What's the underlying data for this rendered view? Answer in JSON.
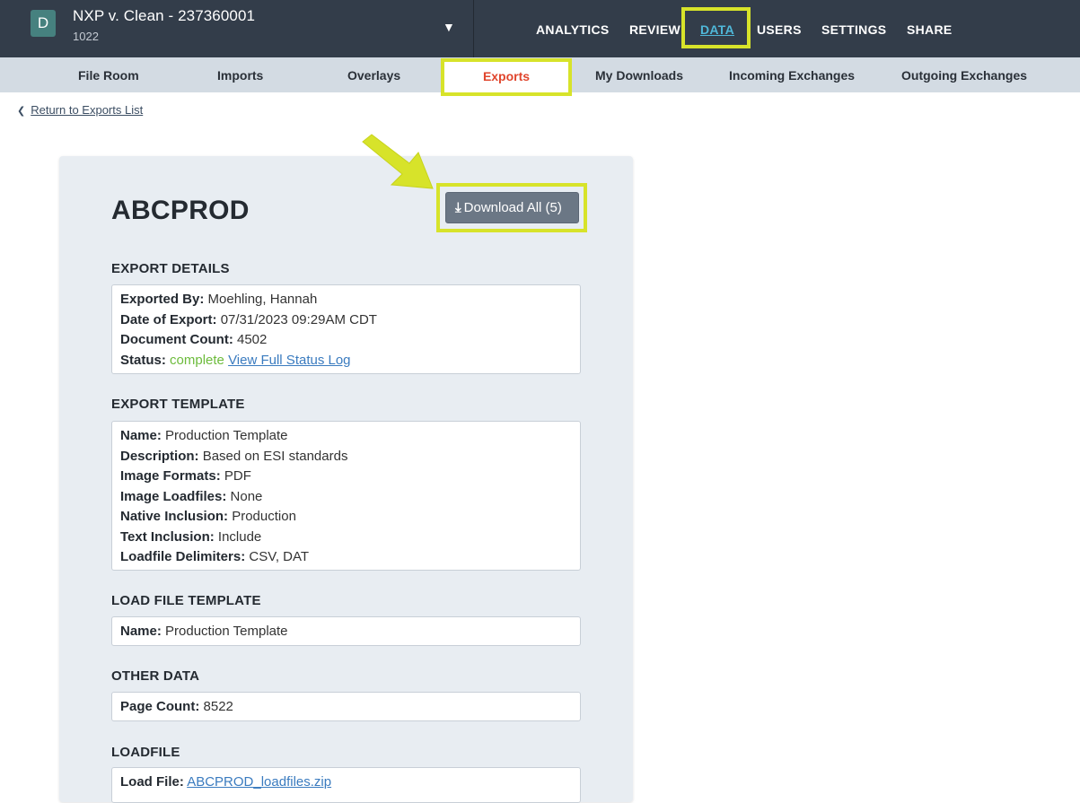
{
  "matter": {
    "badge": "D",
    "title": "NXP v. Clean - 237360001",
    "subtitle": "1022",
    "caret": "▼"
  },
  "main_nav": [
    {
      "label": "ANALYTICS"
    },
    {
      "label": "REVIEW"
    },
    {
      "label": "DATA",
      "active": true
    },
    {
      "label": "USERS"
    },
    {
      "label": "SETTINGS"
    },
    {
      "label": "SHARE"
    }
  ],
  "sub_nav": [
    {
      "label": "File Room"
    },
    {
      "label": "Imports"
    },
    {
      "label": "Overlays"
    },
    {
      "label": "Exports",
      "active": true
    },
    {
      "label": "My Downloads"
    },
    {
      "label": "Incoming Exchanges"
    },
    {
      "label": "Outgoing Exchanges"
    }
  ],
  "return_link": {
    "icon": "chevron-left-icon",
    "label": "Return to Exports List"
  },
  "export": {
    "name": "ABCPROD",
    "download_button": {
      "icon": "download-icon",
      "label": "Download All (5)"
    }
  },
  "export_details": {
    "heading": "EXPORT DETAILS",
    "exported_by_label": "Exported By:",
    "exported_by": "Moehling, Hannah",
    "date_label": "Date of Export:",
    "date": "07/31/2023 09:29AM CDT",
    "doc_count_label": "Document Count:",
    "doc_count": "4502",
    "status_label": "Status:",
    "status": "complete",
    "status_log_link": "View Full Status Log"
  },
  "export_template": {
    "heading": "EXPORT TEMPLATE",
    "rows": [
      {
        "label": "Name:",
        "value": "Production Template"
      },
      {
        "label": "Description:",
        "value": "Based on ESI standards"
      },
      {
        "label": "Image Formats:",
        "value": "PDF"
      },
      {
        "label": "Image Loadfiles:",
        "value": "None"
      },
      {
        "label": "Native Inclusion:",
        "value": "Production"
      },
      {
        "label": "Text Inclusion:",
        "value": "Include"
      },
      {
        "label": "Loadfile Delimiters:",
        "value": "CSV, DAT"
      }
    ]
  },
  "load_file_template": {
    "heading": "LOAD FILE TEMPLATE",
    "name_label": "Name:",
    "name": "Production Template"
  },
  "other_data": {
    "heading": "OTHER DATA",
    "page_count_label": "Page Count:",
    "page_count": "8522"
  },
  "loadfile": {
    "heading": "LOADFILE",
    "label": "Load File:",
    "file": "ABCPROD_loadfiles.zip"
  },
  "colors": {
    "topbar": "#333d4a",
    "highlight": "#d7e32a",
    "active_tab": "#e0452c",
    "status_complete": "#6cbb3b",
    "link": "#3a7bbf"
  }
}
